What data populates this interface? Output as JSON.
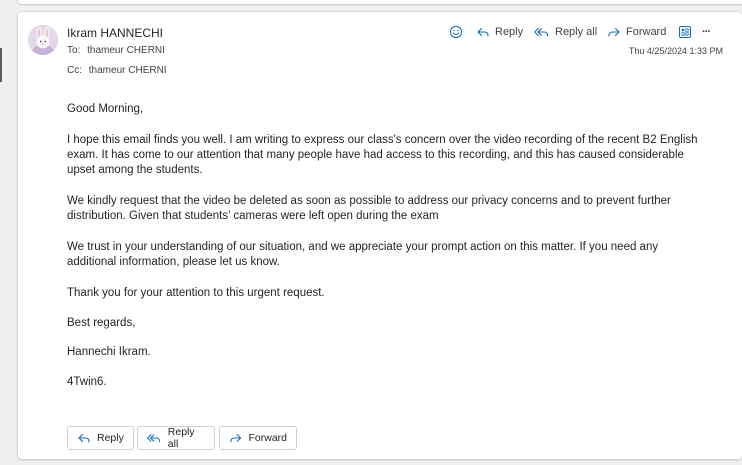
{
  "message": {
    "sender": "Ikram HANNECHI",
    "to_label": "To:",
    "to": "thameur CHERNI",
    "cc_label": "Cc:",
    "cc": "thameur CHERNI",
    "timestamp": "Thu 4/25/2024 1:33 PM"
  },
  "header_actions": {
    "reply": "Reply",
    "reply_all": "Reply all",
    "forward": "Forward",
    "more": "···"
  },
  "body": {
    "greeting": "Good Morning,",
    "p1": "I hope this email finds you well. I am writing to express our class's concern over the video recording of the recent B2 English exam. It has come to our attention that many people have had access to this recording, and this has caused considerable upset among the students.",
    "p2": "We kindly request that the video be deleted as soon as possible to address our privacy concerns and to prevent further distribution. Given that students’ cameras were left open during the exam",
    "p3": "We trust in your understanding of our situation, and we appreciate your prompt action on this matter. If you need any additional information, please let us know.",
    "p4": "Thank you for your attention to this urgent request.",
    "p5": "Best regards,",
    "p6": "Hannechi Ikram.",
    "p7": "4Twin6."
  },
  "footer_actions": {
    "reply": "Reply",
    "reply_all": "Reply all",
    "forward": "Forward"
  },
  "colors": {
    "accent": "#0f6cbd",
    "background": "#f0f0f0",
    "card": "#ffffff"
  }
}
